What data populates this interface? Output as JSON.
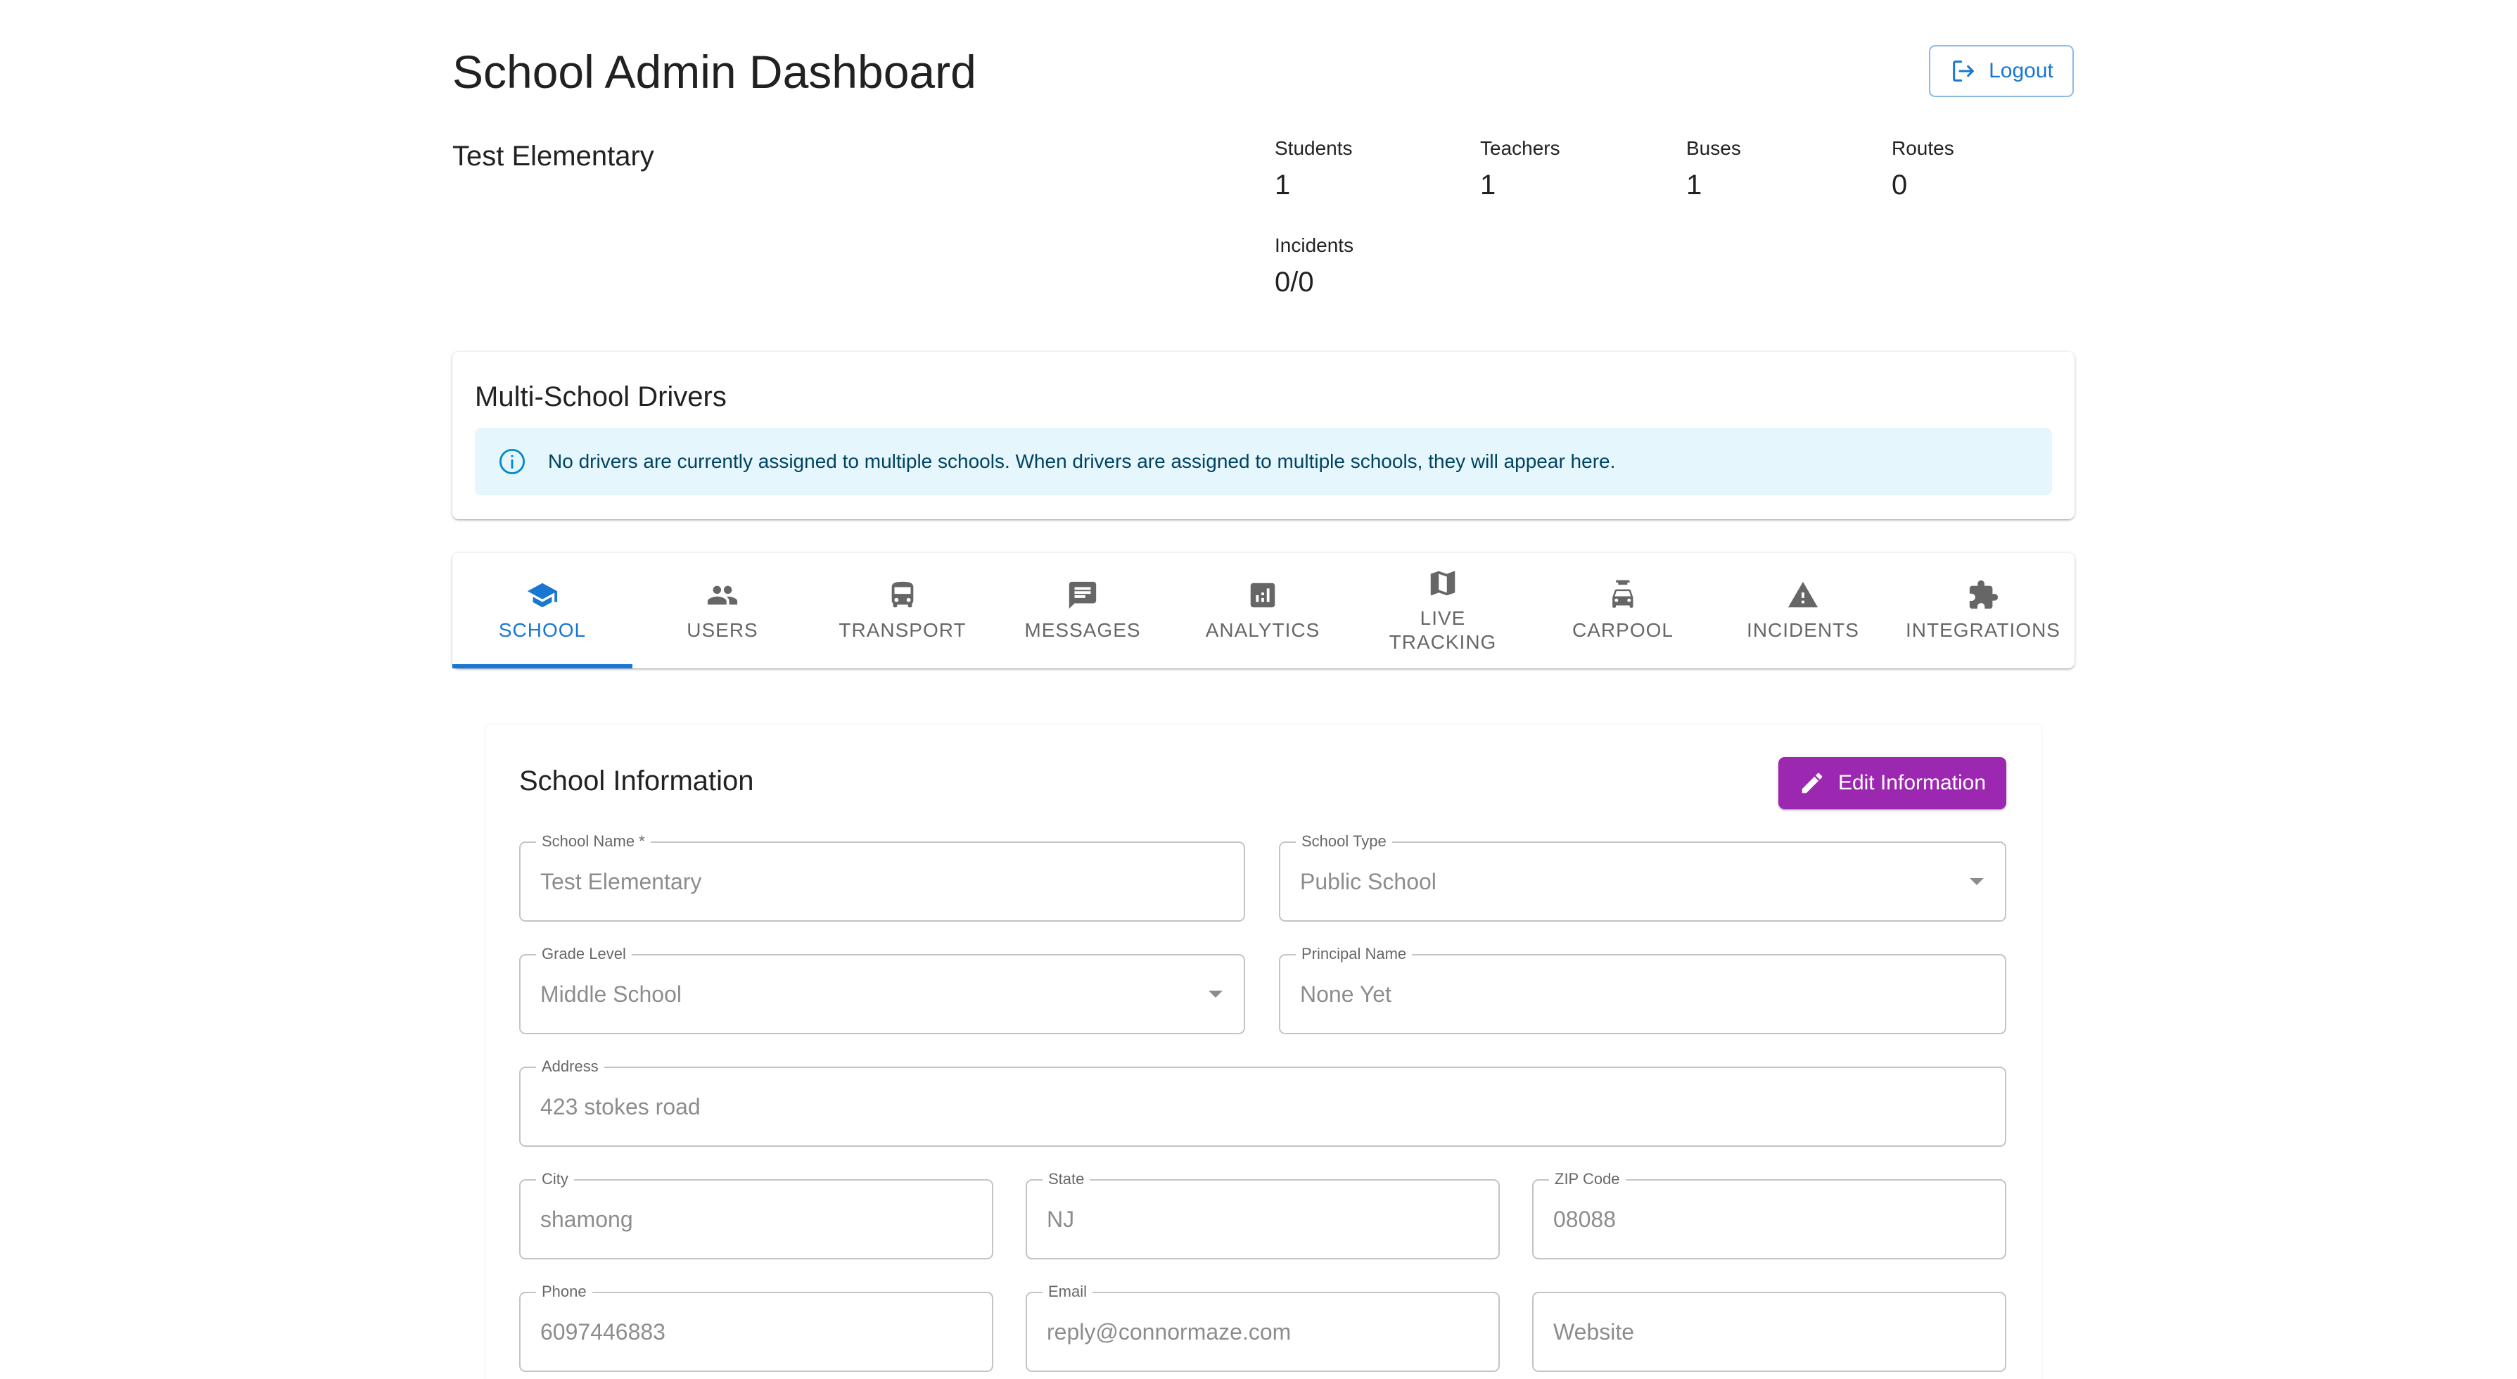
{
  "header": {
    "title": "School Admin Dashboard",
    "logout_label": "Logout",
    "school_name": "Test Elementary"
  },
  "stats": [
    {
      "label": "Students",
      "value": "1"
    },
    {
      "label": "Teachers",
      "value": "1"
    },
    {
      "label": "Buses",
      "value": "1"
    },
    {
      "label": "Routes",
      "value": "0"
    },
    {
      "label": "Incidents",
      "value": "0/0"
    }
  ],
  "multi_school": {
    "title": "Multi-School Drivers",
    "alert": "No drivers are currently assigned to multiple schools. When drivers are assigned to multiple schools, they will appear here."
  },
  "tabs": [
    {
      "label": "SCHOOL",
      "icon": "school-icon",
      "active": true
    },
    {
      "label": "USERS",
      "icon": "people-icon"
    },
    {
      "label": "TRANSPORT",
      "icon": "bus-icon"
    },
    {
      "label": "MESSAGES",
      "icon": "message-icon"
    },
    {
      "label": "ANALYTICS",
      "icon": "analytics-icon"
    },
    {
      "label": "LIVE TRACKING",
      "icon": "map-icon"
    },
    {
      "label": "CARPOOL",
      "icon": "carpool-icon"
    },
    {
      "label": "INCIDENTS",
      "icon": "warning-icon"
    },
    {
      "label": "INTEGRATIONS",
      "icon": "puzzle-icon"
    }
  ],
  "school_info": {
    "title": "School Information",
    "edit_label": "Edit Information",
    "fields": {
      "school_name": {
        "label": "School Name *",
        "value": "Test Elementary"
      },
      "school_type": {
        "label": "School Type",
        "value": "Public School"
      },
      "grade_level": {
        "label": "Grade Level",
        "value": "Middle School"
      },
      "principal": {
        "label": "Principal Name",
        "value": "None Yet"
      },
      "address": {
        "label": "Address",
        "value": "423 stokes road"
      },
      "city": {
        "label": "City",
        "value": "shamong"
      },
      "state": {
        "label": "State",
        "value": "NJ"
      },
      "zip": {
        "label": "ZIP Code",
        "value": "08088"
      },
      "phone": {
        "label": "Phone",
        "value": "6097446883"
      },
      "email": {
        "label": "Email",
        "value": "reply@connormaze.com"
      },
      "website": {
        "placeholder": "Website"
      }
    }
  },
  "colors": {
    "primary": "#1976d2",
    "secondary": "#9c27b0",
    "info_bg": "#e5f6fd"
  }
}
